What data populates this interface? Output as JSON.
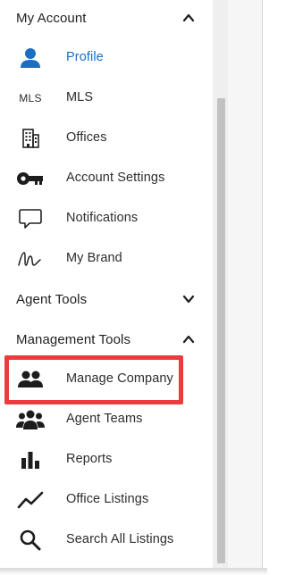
{
  "sections": {
    "my_account": "My Account",
    "agent_tools": "Agent Tools",
    "management_tools": "Management Tools"
  },
  "my_account_items": [
    {
      "label": "Profile",
      "icon": "person-icon",
      "active": true
    },
    {
      "label": "MLS",
      "icon": "mls-text-icon",
      "icon_text": "MLS"
    },
    {
      "label": "Offices",
      "icon": "building-icon"
    },
    {
      "label": "Account Settings",
      "icon": "key-icon"
    },
    {
      "label": "Notifications",
      "icon": "speech-bubble-icon"
    },
    {
      "label": "My Brand",
      "icon": "signature-icon"
    }
  ],
  "management_items": [
    {
      "label": "Manage Company",
      "icon": "people-icon",
      "highlighted": true
    },
    {
      "label": "Agent Teams",
      "icon": "team-icon"
    },
    {
      "label": "Reports",
      "icon": "bar-chart-icon"
    },
    {
      "label": "Office Listings",
      "icon": "trend-line-icon"
    },
    {
      "label": "Search All Listings",
      "icon": "magnifier-icon"
    }
  ],
  "colors": {
    "active": "#1a6fc2",
    "highlight": "#e93c3c",
    "text": "#2d2d2d"
  }
}
